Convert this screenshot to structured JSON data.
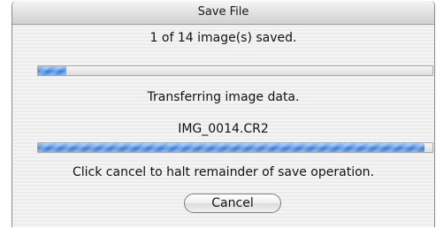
{
  "window": {
    "title": "Save File"
  },
  "status": {
    "count_text": "1 of 14 image(s) saved.",
    "overall_progress": 0.071,
    "transfer_text": "Transferring image data.",
    "filename": "IMG_0014.CR2",
    "file_progress": 0.98,
    "hint_text": "Click cancel to halt remainder of save operation."
  },
  "buttons": {
    "cancel_label": "Cancel"
  },
  "colors": {
    "progress_fill": "#3c7ed8"
  }
}
